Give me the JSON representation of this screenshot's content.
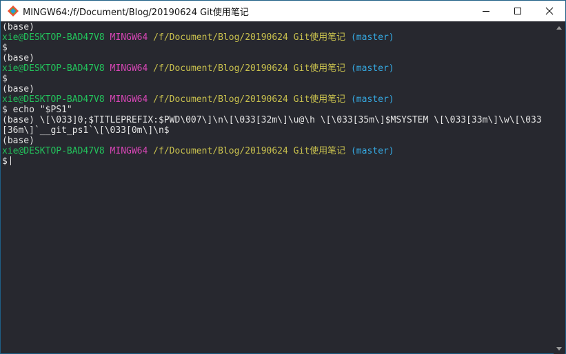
{
  "window": {
    "title": "MINGW64:/f/Document/Blog/20190624 Git使用笔记",
    "controls": {
      "minimize": "minimize",
      "maximize": "maximize",
      "close": "close"
    }
  },
  "terminal": {
    "lines": [
      {
        "type": "text",
        "text": "(base)"
      },
      {
        "type": "prompt",
        "user": "xie@DESKTOP-BAD47V8",
        "system": "MINGW64",
        "path": "/f/Document/Blog/20190624 Git使用笔记",
        "branch": "(master)"
      },
      {
        "type": "text",
        "text": "$"
      },
      {
        "type": "text",
        "text": "(base)"
      },
      {
        "type": "prompt",
        "user": "xie@DESKTOP-BAD47V8",
        "system": "MINGW64",
        "path": "/f/Document/Blog/20190624 Git使用笔记",
        "branch": "(master)"
      },
      {
        "type": "text",
        "text": "$"
      },
      {
        "type": "text",
        "text": "(base)"
      },
      {
        "type": "prompt",
        "user": "xie@DESKTOP-BAD47V8",
        "system": "MINGW64",
        "path": "/f/Document/Blog/20190624 Git使用笔记",
        "branch": "(master)"
      },
      {
        "type": "text",
        "text": "$ echo \"$PS1\""
      },
      {
        "type": "text",
        "text": "(base) \\[\\033]0;$TITLEPREFIX:$PWD\\007\\]\\n\\[\\033[32m\\]\\u@\\h \\[\\033[35m\\]$MSYSTEM \\[\\033[33m\\]\\w\\[\\033"
      },
      {
        "type": "text",
        "text": "[36m\\]`__git_ps1`\\[\\033[0m\\]\\n$"
      },
      {
        "type": "text",
        "text": "(base)"
      },
      {
        "type": "prompt",
        "user": "xie@DESKTOP-BAD47V8",
        "system": "MINGW64",
        "path": "/f/Document/Blog/20190624 Git使用笔记",
        "branch": "(master)"
      },
      {
        "type": "input",
        "text": "$"
      }
    ]
  },
  "colors": {
    "background": "#27282f",
    "user": "#23c45c",
    "system": "#d846b6",
    "path": "#c9c14e",
    "branch": "#35a8e0"
  }
}
